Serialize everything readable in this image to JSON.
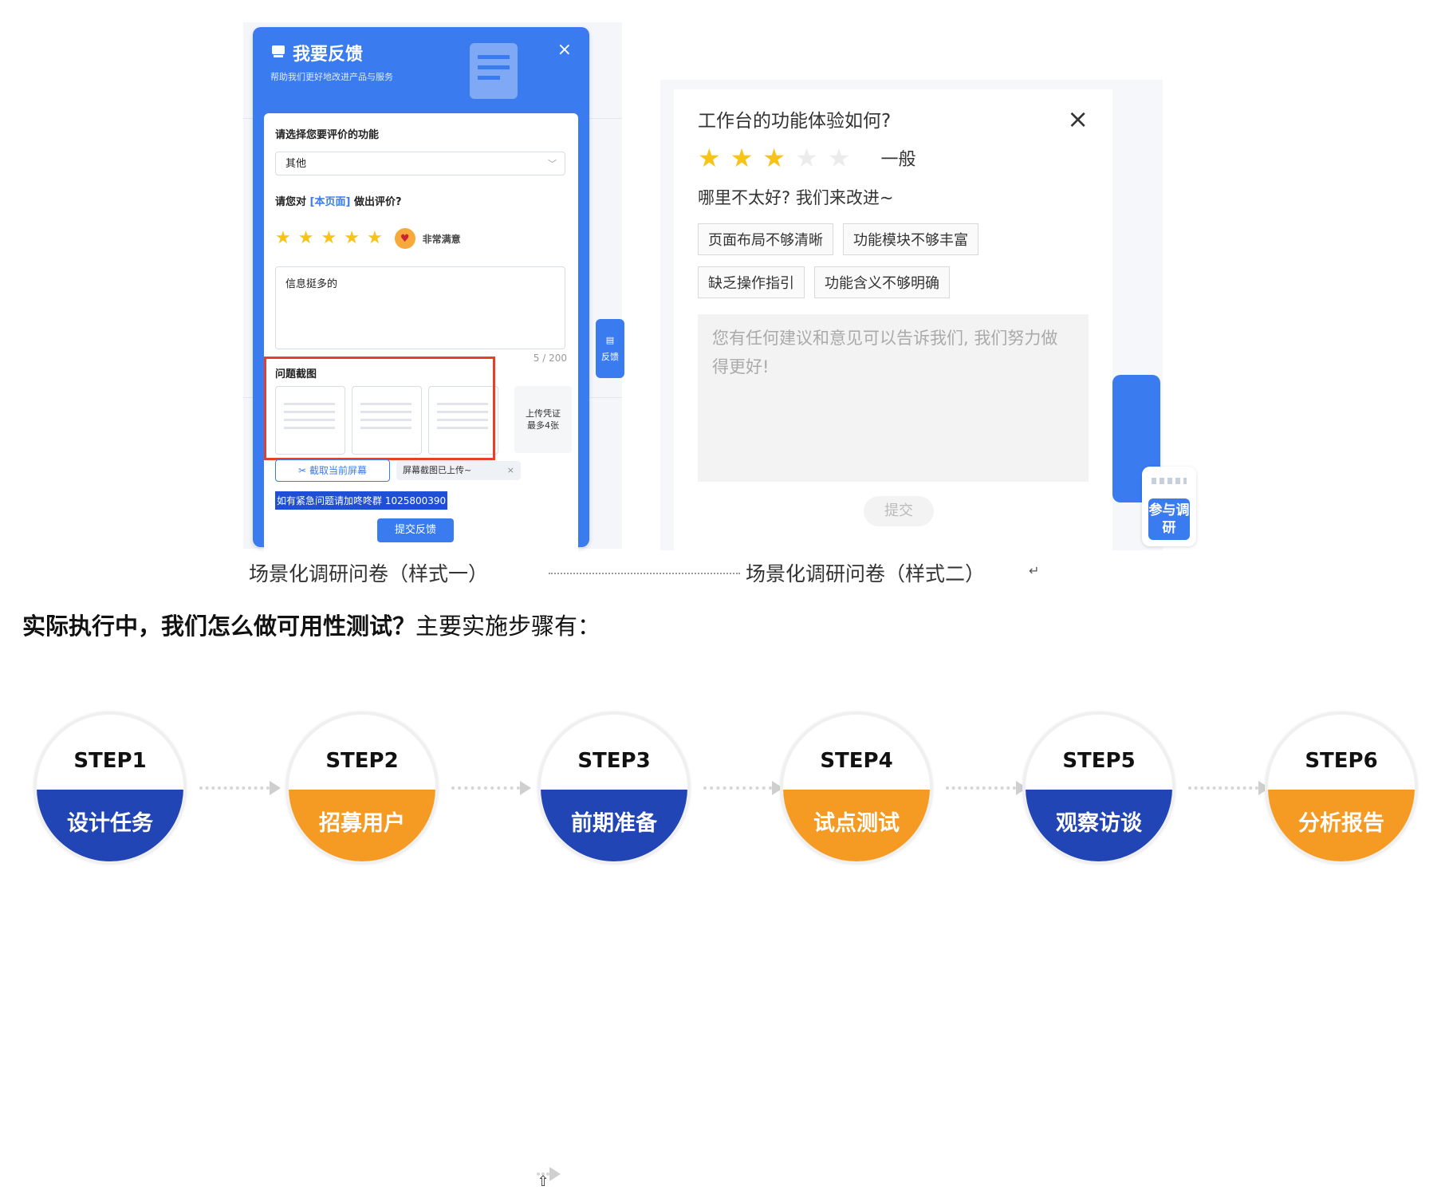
{
  "style1": {
    "title": "我要反馈",
    "subtitle": "帮助我们更好地改进产品与服务",
    "close_icon": "×",
    "select_label": "请选择您要评价的功能",
    "select_value": "其他",
    "rate_label_prefix": "请您对",
    "rate_label_link": "[本页面]",
    "rate_label_suffix": "做出评价?",
    "stars_filled": 5,
    "stars_total": 5,
    "rating_text": "非常满意",
    "feedback_text": "信息挺多的",
    "counter": "5 / 200",
    "screenshot_label": "问题截图",
    "upload_line1": "上传凭证",
    "upload_line2": "最多4张",
    "capture_button": "截取当前屏幕",
    "uploaded_text": "屏幕截图已上传~",
    "urgent_text": "如有紧急问题请加咚咚群 1025800390",
    "submit_button": "提交反馈",
    "side_tab_label": "反馈"
  },
  "style2": {
    "title": "工作台的功能体验如何?",
    "close_icon": "×",
    "stars_filled": 3,
    "stars_total": 5,
    "rating_text": "一般",
    "question": "哪里不太好? 我们来改进~",
    "tags": [
      "页面布局不够清晰",
      "功能模块不够丰富",
      "缺乏操作指引",
      "功能含义不够明确"
    ],
    "placeholder": "您有任何建议和意见可以告诉我们, 我们努力做得更好!",
    "submit_button": "提交",
    "join_button": "参与调研"
  },
  "captions": {
    "left": "场景化调研问卷（样式一）",
    "right": "场景化调研问卷（样式二）"
  },
  "question": {
    "bold": "实际执行中，我们怎么做可用性测试？",
    "normal": "主要实施步骤有："
  },
  "steps": [
    {
      "label": "STEP1",
      "name": "设计任务",
      "color": "#2145b4"
    },
    {
      "label": "STEP2",
      "name": "招募用户",
      "color": "#f59a23"
    },
    {
      "label": "STEP3",
      "name": "前期准备",
      "color": "#2145b4"
    },
    {
      "label": "STEP4",
      "name": "试点测试",
      "color": "#f59a23"
    },
    {
      "label": "STEP5",
      "name": "观察访谈",
      "color": "#2145b4"
    },
    {
      "label": "STEP6",
      "name": "分析报告",
      "color": "#f59a23"
    }
  ]
}
